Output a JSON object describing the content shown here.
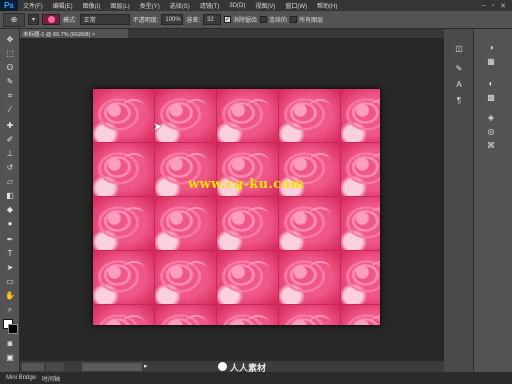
{
  "app": {
    "logo": "Ps"
  },
  "menu": [
    "文件(F)",
    "编辑(E)",
    "图像(I)",
    "图层(L)",
    "类型(Y)",
    "选择(S)",
    "滤镜(T)",
    "3D(D)",
    "视图(V)",
    "窗口(W)",
    "帮助(H)"
  ],
  "window_controls": [
    "–",
    "▫",
    "✕"
  ],
  "options": {
    "preset_icon": "brush-preset-icon",
    "mode_value": "正常",
    "mode_label": "模式:",
    "opacity_label": "不透明度:",
    "opacity_value": "100%",
    "tolerance_label": "容差:",
    "tolerance_value": "32",
    "antialias_label": "消除锯齿",
    "contiguous_label": "连续的",
    "alllayers_label": "所有图层",
    "swatch_color": "#ff6aa4"
  },
  "document": {
    "tab_label": "未标题-1 @ 66.7% (RGB/8) ×",
    "tile_rows": 5,
    "tile_cols": 5,
    "watermark_text": "www.cg-ku.com"
  },
  "colors": {
    "foreground": "#ffffff",
    "background": "#000000",
    "accent": "#d63868"
  },
  "status": {
    "site_text": "人人素材"
  },
  "bottom": {
    "item1": "Mini Bridge",
    "item2": "时间轴"
  }
}
